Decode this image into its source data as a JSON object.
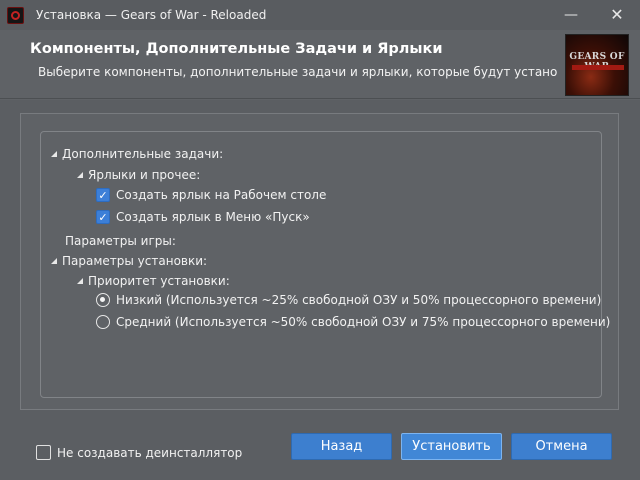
{
  "window": {
    "title": "Установка — Gears of War - Reloaded",
    "minimize_glyph": "—",
    "close_glyph": "✕"
  },
  "header": {
    "title": "Компоненты, Дополнительные Задачи и Ярлыки",
    "subtitle": "Выберите компоненты, дополнительные задачи и ярлыки, которые будут установлены",
    "image_text": "GEARS OF WAR"
  },
  "tree": {
    "additional_tasks": "Дополнительные задачи:",
    "shortcuts_group": "Ярлыки и прочее:",
    "desktop_shortcut": {
      "label": "Создать ярлык на Рабочем столе",
      "checked": true
    },
    "start_menu_shortcut": {
      "label": "Создать ярлык в Меню «Пуск»",
      "checked": true
    },
    "game_params": "Параметры игры:",
    "install_params": "Параметры установки:",
    "install_priority": "Приоритет установки:",
    "priority_low": {
      "label": "Низкий (Используется ~25% свободной ОЗУ и 50% процессорного времени)",
      "selected": true
    },
    "priority_medium": {
      "label": "Средний (Используется ~50% свободной ОЗУ и 75% процессорного времени)",
      "selected": false
    }
  },
  "footer": {
    "no_uninstaller": {
      "label": "Не создавать деинсталлятор",
      "checked": false
    },
    "back_label": "Назад",
    "install_label": "Установить",
    "cancel_label": "Отмена"
  },
  "icons": {
    "checkmark": "✓"
  },
  "colors": {
    "accent": "#3d7fcf",
    "background": "#5b5e62"
  }
}
